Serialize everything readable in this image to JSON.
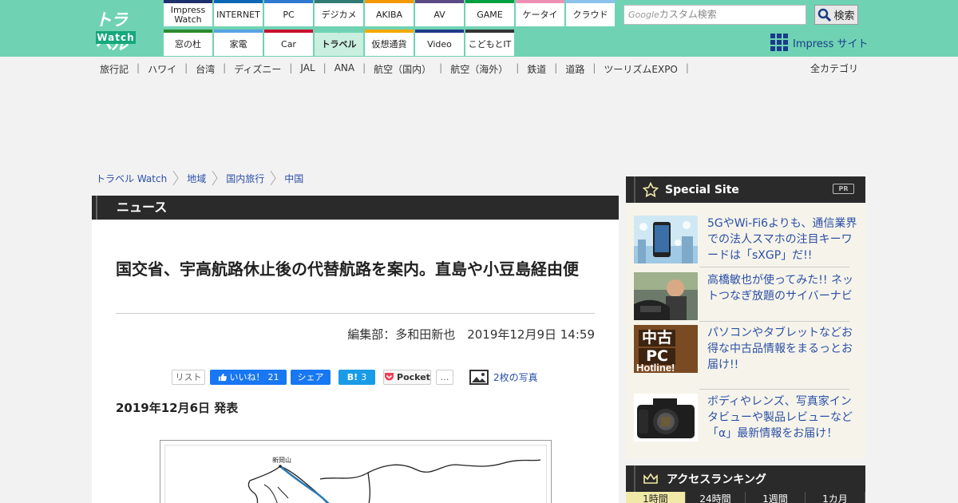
{
  "logo": {
    "line1": "トラベル",
    "line2": "Watch"
  },
  "nav": {
    "row1": [
      {
        "label": "Impress\nWatch",
        "color": "#1e2f6e"
      },
      {
        "label": "INTERNET",
        "color": "#0a67b5"
      },
      {
        "label": "PC",
        "color": "#2f78cf"
      },
      {
        "label": "デジカメ",
        "color": "#2f7a73"
      },
      {
        "label": "AKIBA",
        "color": "#f39800"
      },
      {
        "label": "AV",
        "color": "#5a4a86"
      },
      {
        "label": "GAME",
        "color": "#00a040"
      },
      {
        "label": "ケータイ",
        "color": "#ef8fb3"
      },
      {
        "label": "クラウド",
        "color": "#89c3eb"
      }
    ],
    "row2": [
      {
        "label": "窓の杜",
        "color": "#2c8a2c"
      },
      {
        "label": "家電",
        "color": "#58a3e5"
      },
      {
        "label": "Car",
        "color": "#c8102e"
      },
      {
        "label": "トラベル",
        "color": "#6fd3b3",
        "active": true
      },
      {
        "label": "仮想通貨",
        "color": "#f2a900"
      },
      {
        "label": "Video",
        "color": "#1e3b8a"
      },
      {
        "label": "こどもとIT",
        "color": "#333333"
      }
    ]
  },
  "search": {
    "google": "Google",
    "placeholder": "カスタム検索",
    "button": "検索"
  },
  "impress_site": "Impress サイト",
  "subnav": [
    "旅行記",
    "ハワイ",
    "台湾",
    "ディズニー",
    "JAL",
    "ANA",
    "航空（国内）",
    "航空（海外）",
    "鉄道",
    "道路",
    "ツーリズムEXPO"
  ],
  "all_categories": "全カテゴリ",
  "breadcrumb": [
    "トラベル Watch",
    "地域",
    "国内旅行",
    "中国"
  ],
  "section_header": "ニュース",
  "article": {
    "title": "国交省、宇高航路休止後の代替航路を案内。直島や小豆島経由便",
    "byline": "編集部：多和田新也　2019年12月9日 14:59",
    "published": "2019年12月6日 発表",
    "map_label": "新岡山"
  },
  "share": {
    "list": "リスト",
    "fb_like": "いいね！",
    "fb_like_count": "21",
    "fb_share": "シェア",
    "hatena": "B!",
    "hatena_count": "3",
    "pocket": "Pocket",
    "more": "…",
    "photos": "2枚の写真"
  },
  "special_site": {
    "title": "Special Site",
    "pr": "PR",
    "items": [
      {
        "text": "5GやWi-Fi6よりも、通信業界での法人スマホの注目キーワードは「sXGP」だ!!"
      },
      {
        "text": "高橋敏也が使ってみた!! ネットつなぎ放題のサイバーナビ"
      },
      {
        "text": "パソコンやタブレットなどお得な中古品情報をまるっとお届け!!",
        "thumb_lines": [
          "中古",
          "PC",
          "Hotline!"
        ]
      },
      {
        "text": "ボディやレンズ、写真家インタビューや製品レビューなど「α」最新情報をお届け！"
      }
    ]
  },
  "ranking": {
    "title": "アクセスランキング",
    "tabs": [
      "1時間",
      "24時間",
      "1週間",
      "1カ月"
    ]
  }
}
